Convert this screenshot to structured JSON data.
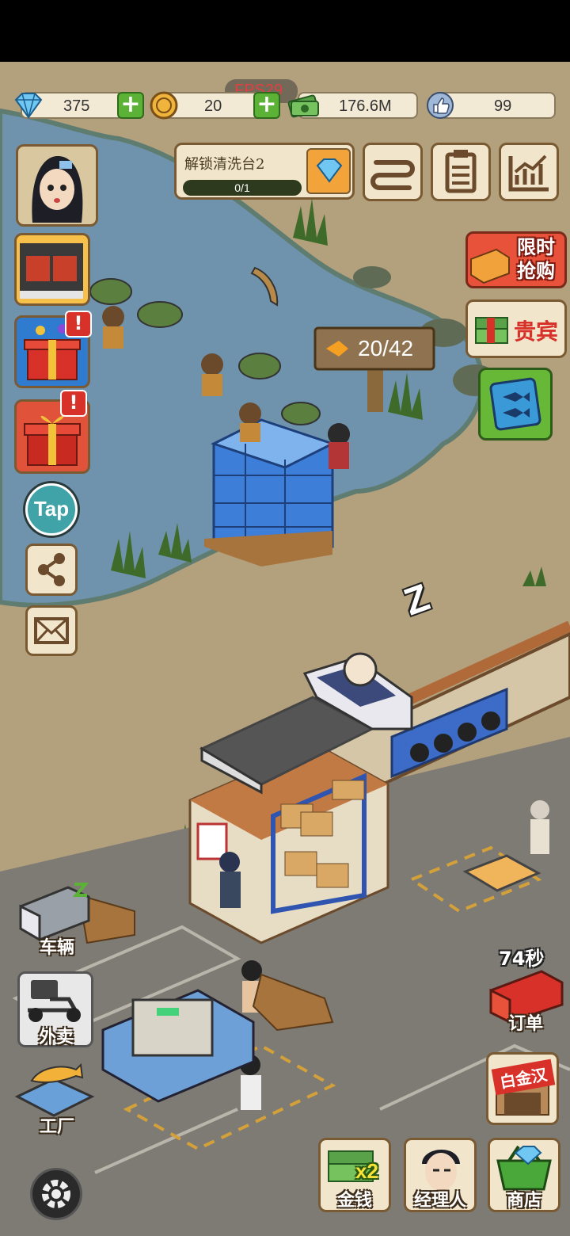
{
  "hud": {
    "fps": "FPS29",
    "diamonds": "375",
    "coins": "20",
    "cash": "176.6M",
    "likes": "99"
  },
  "task": {
    "title": "解锁清洗台2",
    "progress_text": "0/1",
    "progress": 0
  },
  "pond": {
    "fish_counter": "20/42"
  },
  "right_menu": {
    "flash_sale": "限时抢购",
    "vip": "贵宾"
  },
  "left_menu": {
    "tap_label": "Tap"
  },
  "bottom_left": {
    "vehicles": "车辆",
    "takeout": "外卖",
    "factory": "工厂"
  },
  "bottom_right": {
    "order_timer": "74秒",
    "orders": "订单",
    "store_sign": "白金汉",
    "money": "金钱",
    "money_multiplier": "x2",
    "manager": "经理人",
    "shop": "商店"
  },
  "misc": {
    "sleep_z": "Z"
  },
  "colors": {
    "water": "#6f93ad",
    "sand": "#b7a481",
    "road": "#7d7b74",
    "ui_frame": "#7a5a32",
    "ui_fill": "#f1e5cc",
    "accent_green": "#5bb236",
    "badge_red": "#d8312a"
  }
}
